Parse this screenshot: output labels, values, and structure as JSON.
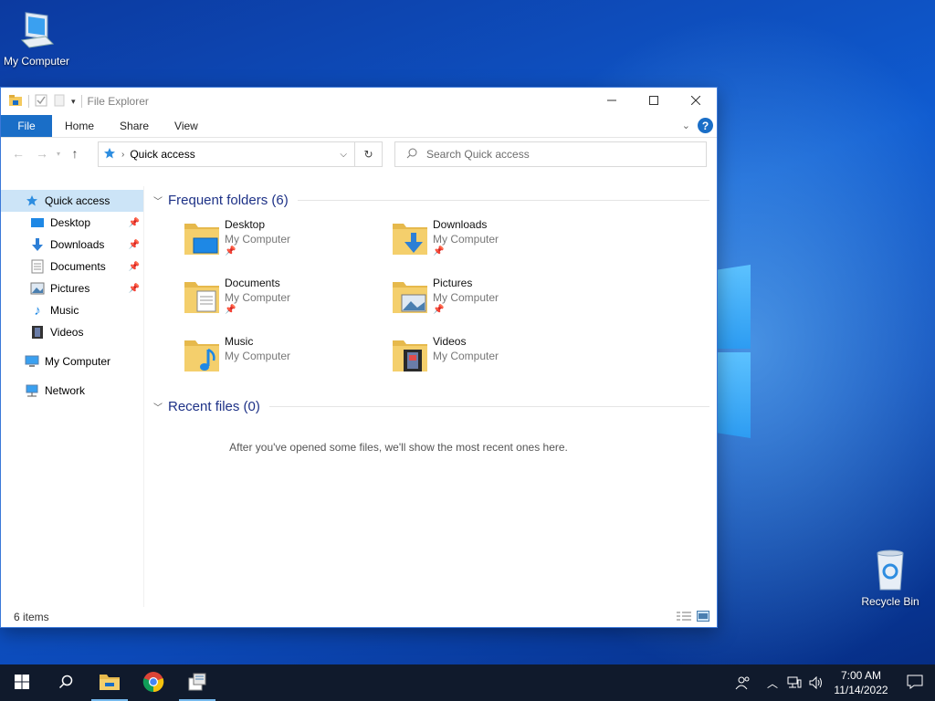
{
  "desktop": {
    "icons": {
      "my_computer": "My Computer",
      "recycle_bin": "Recycle Bin"
    }
  },
  "window": {
    "title": "File Explorer",
    "controls": {
      "minimize": "minimize-icon",
      "maximize": "maximize-icon",
      "close": "close-icon"
    },
    "ribbon": {
      "tabs": [
        {
          "label": "File"
        },
        {
          "label": "Home"
        },
        {
          "label": "Share"
        },
        {
          "label": "View"
        }
      ]
    },
    "nav": {
      "address": "Quick access",
      "search_placeholder": "Search Quick access"
    },
    "sidebar": {
      "items": [
        {
          "label": "Quick access",
          "icon": "star-icon",
          "active": true
        },
        {
          "label": "Desktop",
          "icon": "desktop-icon",
          "pinned": true
        },
        {
          "label": "Downloads",
          "icon": "download-icon",
          "pinned": true
        },
        {
          "label": "Documents",
          "icon": "documents-icon",
          "pinned": true
        },
        {
          "label": "Pictures",
          "icon": "pictures-icon",
          "pinned": true
        },
        {
          "label": "Music",
          "icon": "music-icon"
        },
        {
          "label": "Videos",
          "icon": "videos-icon"
        },
        {
          "label": "My Computer",
          "icon": "computer-icon"
        },
        {
          "label": "Network",
          "icon": "network-icon"
        }
      ]
    },
    "frequent": {
      "header": "Frequent folders (6)",
      "folders": [
        {
          "name": "Desktop",
          "location": "My Computer",
          "pinned": true
        },
        {
          "name": "Downloads",
          "location": "My Computer",
          "pinned": true
        },
        {
          "name": "Documents",
          "location": "My Computer",
          "pinned": true
        },
        {
          "name": "Pictures",
          "location": "My Computer",
          "pinned": true
        },
        {
          "name": "Music",
          "location": "My Computer",
          "pinned": false
        },
        {
          "name": "Videos",
          "location": "My Computer",
          "pinned": false
        }
      ]
    },
    "recent": {
      "header": "Recent files (0)",
      "empty_message": "After you've opened some files, we'll show the most recent ones here."
    },
    "status": {
      "items_count": "6 items"
    }
  },
  "taskbar": {
    "time": "7:00 AM",
    "date": "11/14/2022"
  },
  "colors": {
    "accent": "#1a6ec7",
    "folder": "#f4c95d",
    "taskbar": "#101a2c",
    "selection": "#cce4f7",
    "group_header": "#1e3287"
  }
}
